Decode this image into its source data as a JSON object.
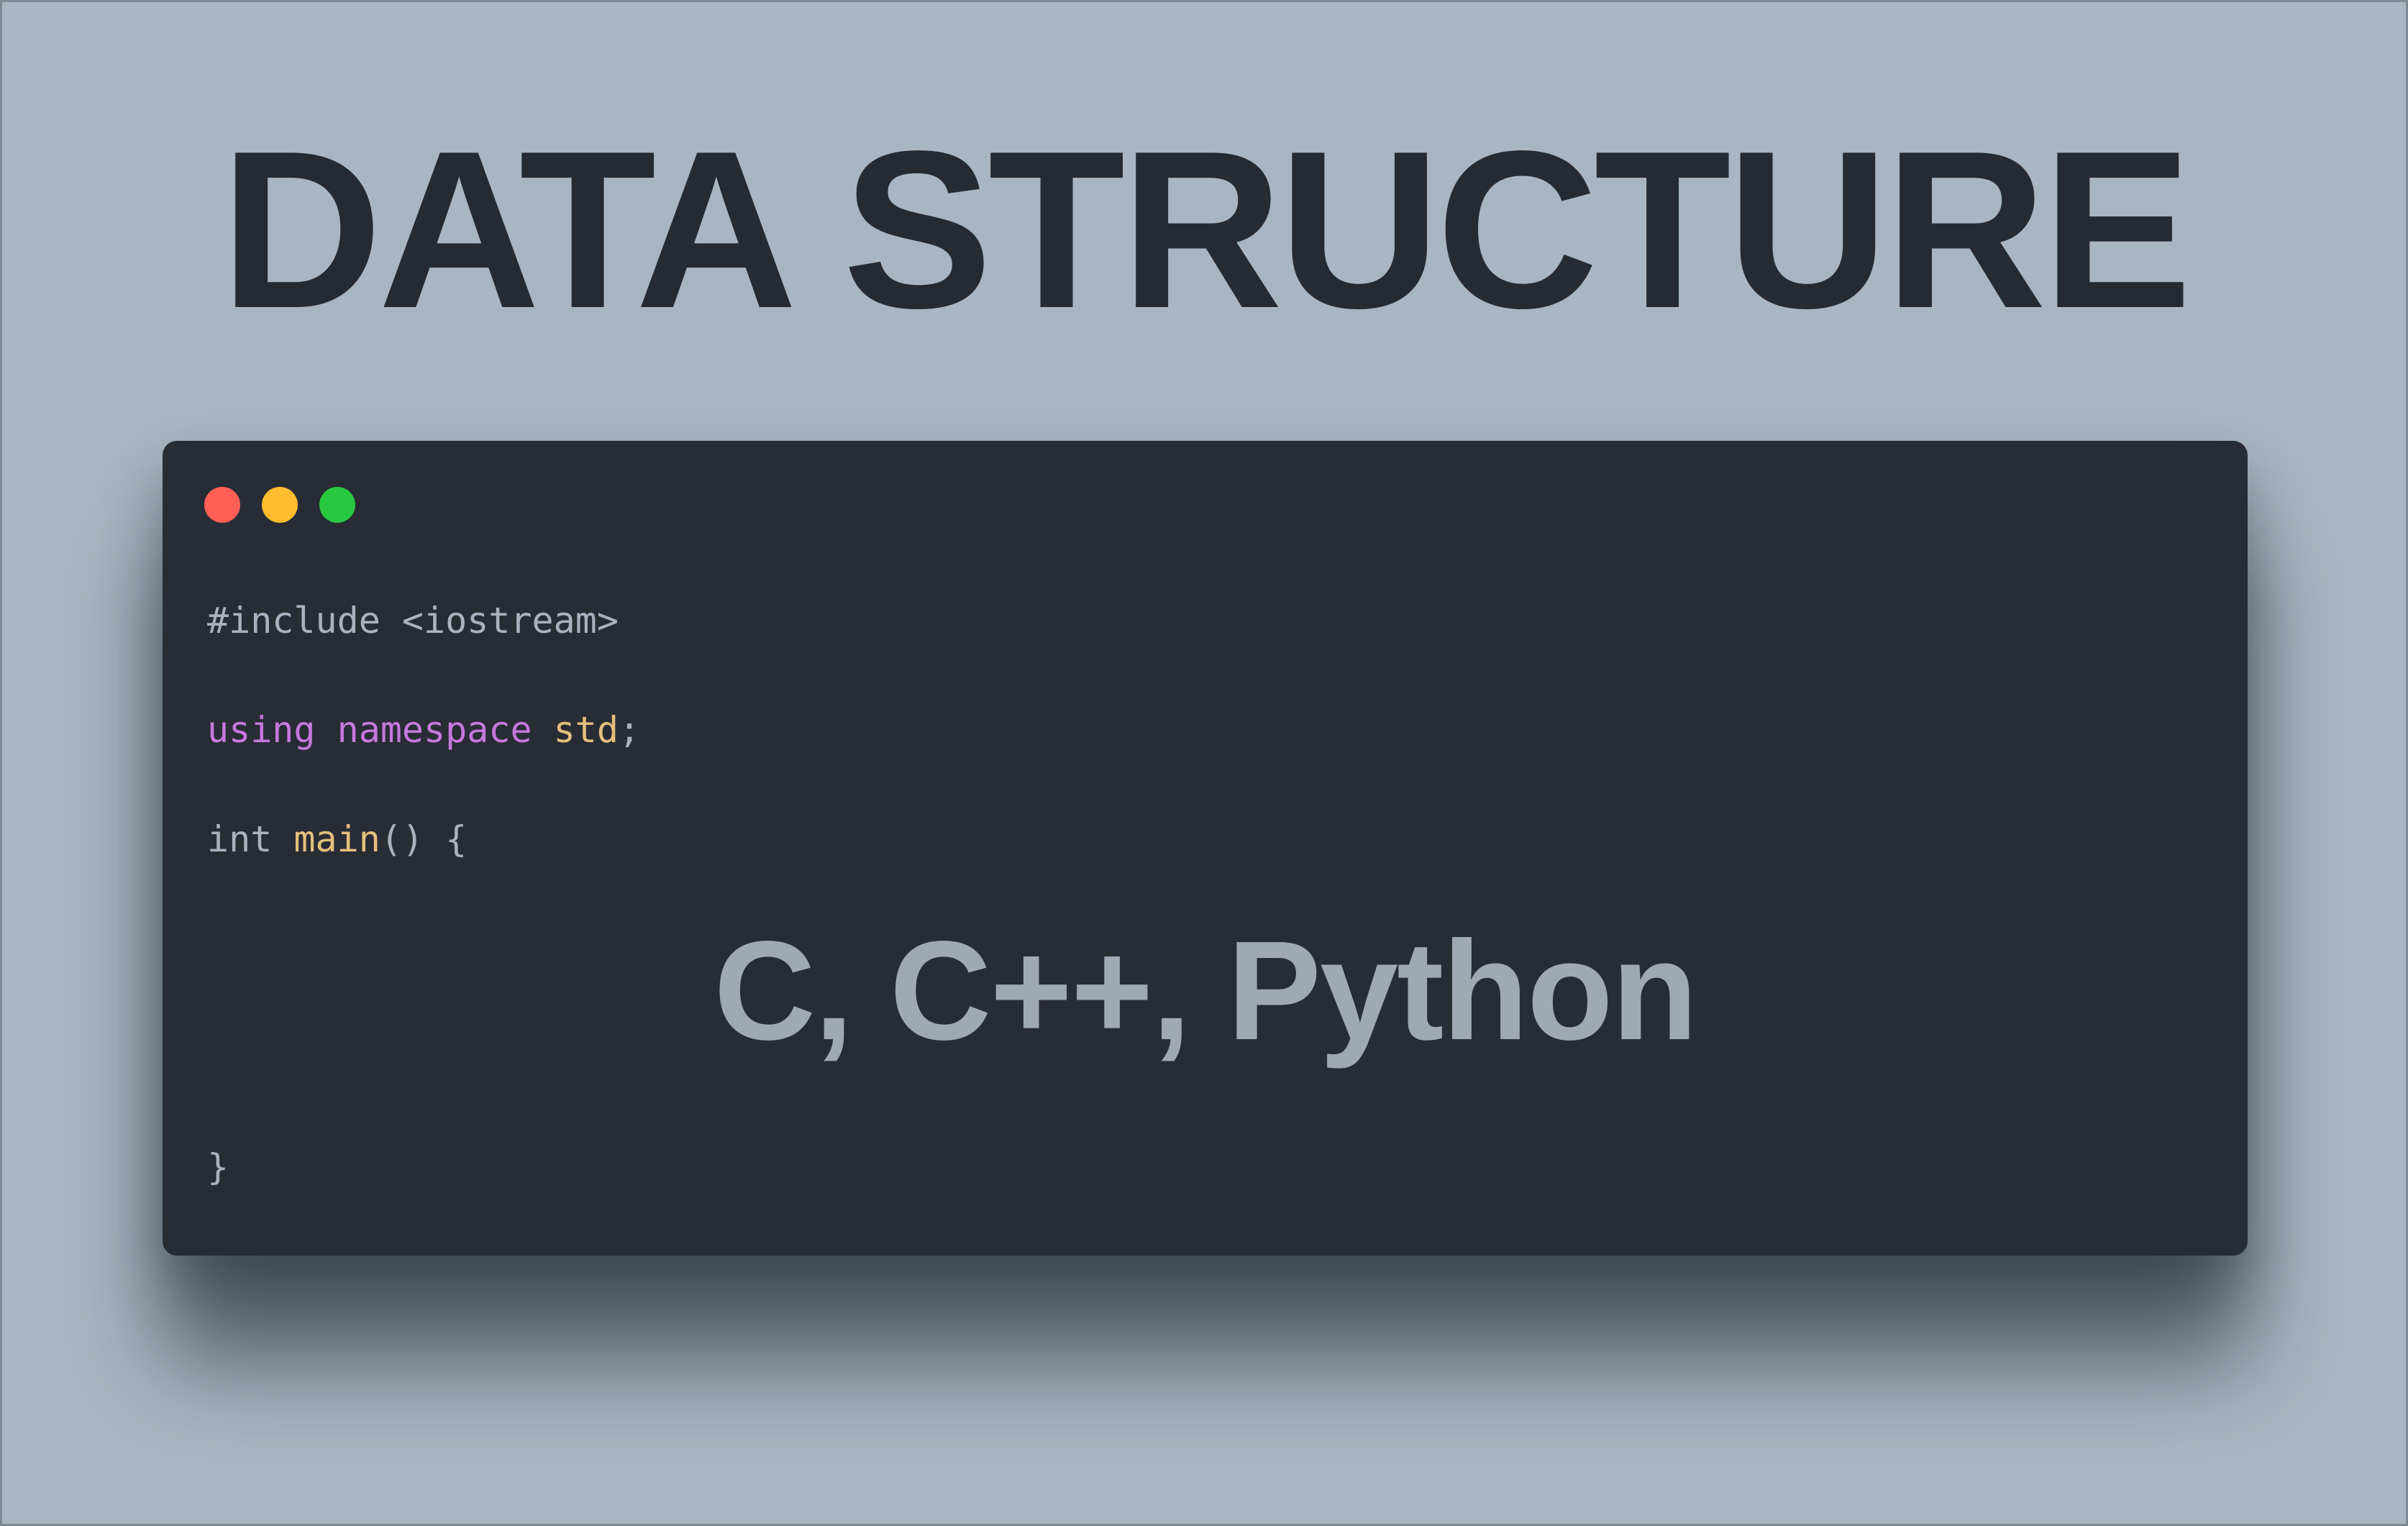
{
  "headline": "DATA STRUCTURE",
  "window": {
    "lights": {
      "close_color": "#ff5f57",
      "minimize_color": "#febc2e",
      "maximize_color": "#28c840"
    },
    "code": {
      "line1": "#include <iostream>",
      "line2_kw1": "using",
      "line2_kw2": "namespace",
      "line2_ns": "std",
      "line2_end": ";",
      "line3_type": "int",
      "line3_fn": "main",
      "line3_rest": "() {",
      "line4": "}"
    },
    "overlay": "C, C++, Python"
  },
  "colors": {
    "background": "#a8b6c3",
    "headline": "#262a33",
    "editor_bg": "#282c35",
    "keyword": "#c678dd",
    "identifier": "#e5c07b",
    "plain_code": "#abb2bf",
    "overlay_text": "#a0a8b4"
  }
}
